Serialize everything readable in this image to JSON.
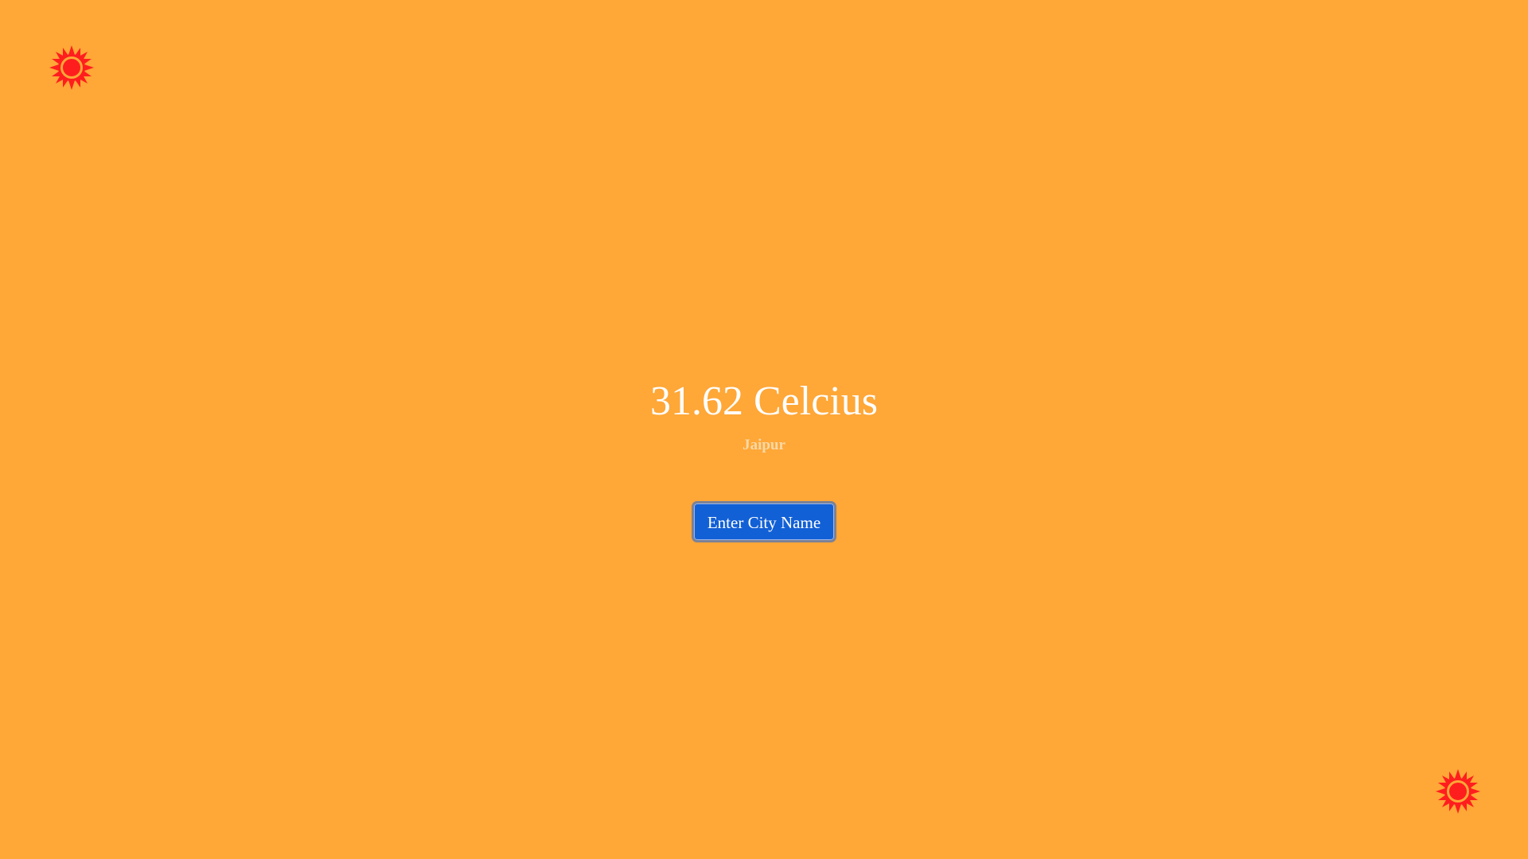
{
  "weather": {
    "temperature": "31.62 Celcius",
    "city": "Jaipur"
  },
  "actions": {
    "city_button_label": "Enter City Name"
  },
  "icons": {
    "top_left": "sun-icon",
    "bottom_right": "sun-icon"
  },
  "colors": {
    "background": "#FFA737",
    "sun": "#FF1E1E",
    "button": "#1260D6",
    "temperature_text": "#FFFFFF",
    "city_text": "#F8D9A6"
  }
}
